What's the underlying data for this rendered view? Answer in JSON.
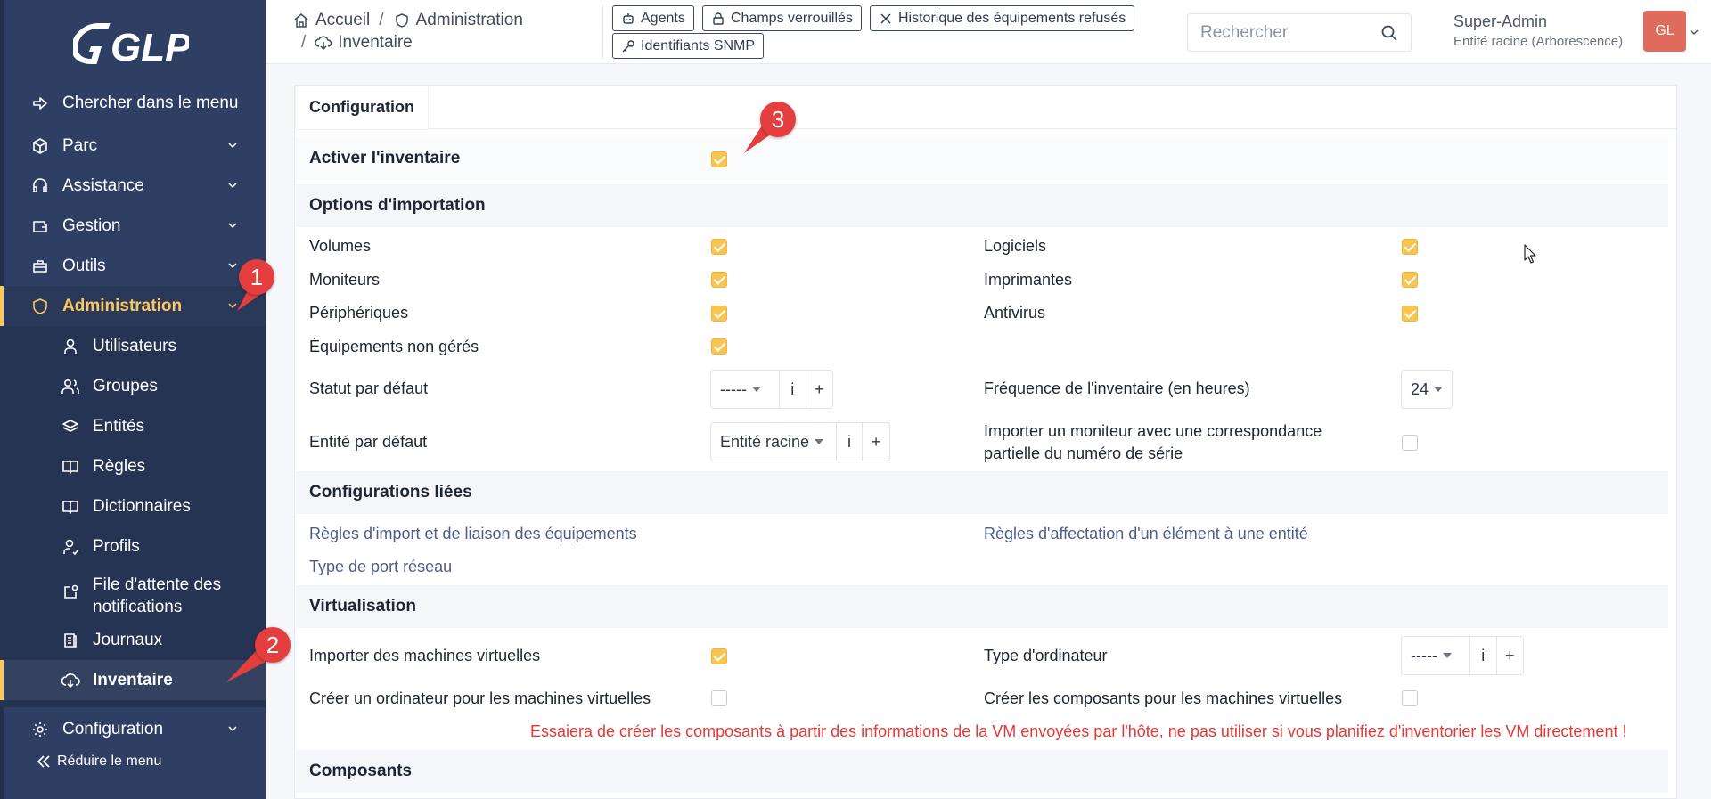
{
  "app": {
    "logo_text": "GLPI"
  },
  "sidebar": {
    "search_menu": "Chercher dans le menu",
    "items": [
      {
        "label": "Parc",
        "icon": "cube-icon"
      },
      {
        "label": "Assistance",
        "icon": "headset-icon"
      },
      {
        "label": "Gestion",
        "icon": "wallet-icon"
      },
      {
        "label": "Outils",
        "icon": "briefcase-icon"
      },
      {
        "label": "Administration",
        "icon": "shield-icon"
      }
    ],
    "admin_subitems": [
      {
        "label": "Utilisateurs",
        "icon": "user-icon"
      },
      {
        "label": "Groupes",
        "icon": "users-icon"
      },
      {
        "label": "Entités",
        "icon": "layers-icon"
      },
      {
        "label": "Règles",
        "icon": "book-icon"
      },
      {
        "label": "Dictionnaires",
        "icon": "book-icon"
      },
      {
        "label": "Profils",
        "icon": "user-check-icon"
      },
      {
        "label": "File d'attente des notifications",
        "icon": "notification-icon"
      },
      {
        "label": "Journaux",
        "icon": "log-icon"
      },
      {
        "label": "Inventaire",
        "icon": "cloud-download-icon"
      }
    ],
    "configuration": "Configuration",
    "reduce": "Réduire le menu"
  },
  "header": {
    "breadcrumb": {
      "home": "Accueil",
      "admin": "Administration",
      "current": "Inventaire"
    },
    "buttons": {
      "agents": "Agents",
      "locked_fields": "Champs verrouillés",
      "refused_history": "Historique des équipements refusés",
      "snmp": "Identifiants SNMP"
    },
    "search_placeholder": "Rechercher",
    "user_name": "Super-Admin",
    "user_entity": "Entité racine (Arborescence)",
    "avatar_initials": "GL"
  },
  "main": {
    "tab": "Configuration",
    "enable_inventory": {
      "label": "Activer l'inventaire",
      "checked": true
    },
    "import_options": {
      "title": "Options d'importation",
      "volumes": {
        "label": "Volumes",
        "checked": true
      },
      "software": {
        "label": "Logiciels",
        "checked": true
      },
      "monitors": {
        "label": "Moniteurs",
        "checked": true
      },
      "printers": {
        "label": "Imprimantes",
        "checked": true
      },
      "peripherals": {
        "label": "Périphériques",
        "checked": true
      },
      "antivirus": {
        "label": "Antivirus",
        "checked": true
      },
      "unmanaged": {
        "label": "Équipements non gérés",
        "checked": true
      },
      "default_status": {
        "label": "Statut par défaut",
        "value": "-----"
      },
      "frequency": {
        "label": "Fréquence de l'inventaire (en heures)",
        "value": "24"
      },
      "default_entity": {
        "label": "Entité par défaut",
        "value": "Entité racine"
      },
      "partial_monitor": {
        "label_line1": "Importer un moniteur avec une correspondance",
        "label_line2": "partielle du numéro de série",
        "checked": false
      }
    },
    "linked_configs": {
      "title": "Configurations liées",
      "import_rules": "Règles d'import et de liaison des équipements",
      "entity_rules": "Règles d'affectation d'un élément à une entité",
      "port_type": "Type de port réseau"
    },
    "virtualization": {
      "title": "Virtualisation",
      "import_vms": {
        "label": "Importer des machines virtuelles",
        "checked": true
      },
      "computer_type": {
        "label": "Type d'ordinateur",
        "value": "-----"
      },
      "create_computer": {
        "label": "Créer un ordinateur pour les machines virtuelles",
        "checked": false
      },
      "create_components": {
        "label": "Créer les composants pour les machines virtuelles",
        "checked": false
      },
      "warning": "Essaiera de créer les composants à partir des informations de la VM envoyées par l'hôte, ne pas utiliser si vous planifiez d'inventorier les VM directement !"
    },
    "components": {
      "title": "Composants"
    }
  },
  "annotations": [
    {
      "number": "1"
    },
    {
      "number": "2"
    },
    {
      "number": "3"
    }
  ],
  "colors": {
    "sidebar_bg": "#2f3f64",
    "accent": "#fec95c",
    "checkbox": "#f9c552",
    "marker": "#e53e3e",
    "warning": "#e53935"
  }
}
